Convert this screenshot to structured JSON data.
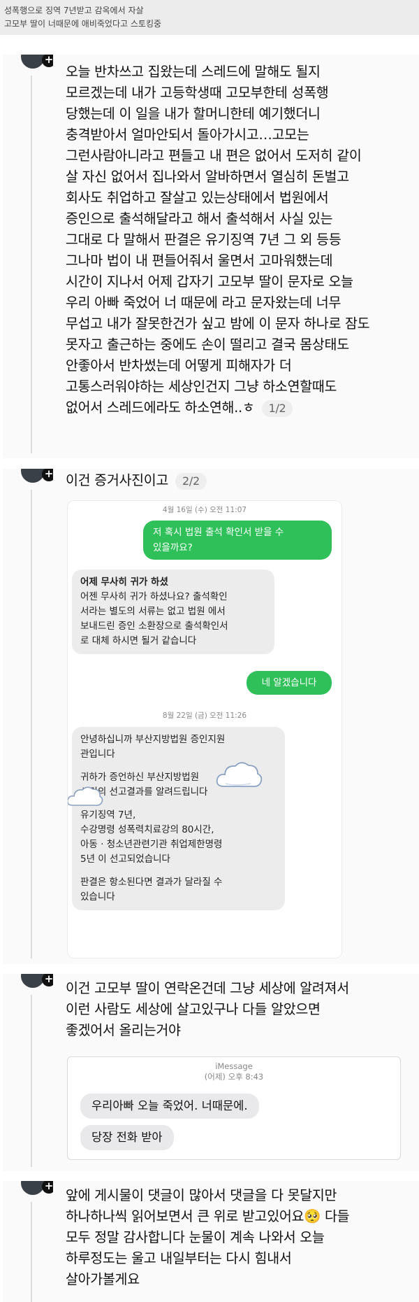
{
  "header": {
    "line1": "성폭행으로 징역 7년받고 감옥에서 자살",
    "line2": "고모부 딸이 너때문에 애비죽었다고 스토킹중"
  },
  "post1": {
    "lines": [
      "오늘 반차쓰고 집왔는데 스레드에 말해도 될지",
      "모르겠는데 내가 고등학생때 고모부한테 성폭행",
      "당했는데 이 일을 내가 할머니한테 예기했더니",
      "충격받아서 얼마안되서 돌아가시고…고모는",
      "그런사람아니라고 편들고 내 편은 없어서 도저히 같이",
      "살 자신 없어서 집나와서 알바하면서 열심히 돈벌고",
      "회사도 취업하고 잘살고 있는상태에서 법원에서",
      "증인으로 출석해달라고 해서 출석해서 사실 있는",
      "그대로 다 말해서 판결은 유기징역 7년 그 외 등등",
      "그나마 법이 내 편들어줘서 울면서 고마워했는데",
      "시간이 지나서 어제 갑자기 고모부 딸이 문자로 오늘",
      "우리 아빠 죽었어 너 때문에 라고 문자왔는데 너무",
      "무섭고 내가 잘못한건가 싶고 밤에 이 문자 하나로 잠도",
      "못자고 출근하는 중에도 손이 떨리고 결국 몸상태도",
      "안좋아서 반차썼는데 어떻게 피해자가 더",
      "고통스러워야하는 세상인건지 그냥 하소연할때도"
    ],
    "last_line": "없어서 스레드에라도 하소연해..ㅎ",
    "counter": "1/2"
  },
  "post2": {
    "text": "이건 증거사진이고",
    "counter": "2/2",
    "screenshot": {
      "date1": "4월 16일 (수) 오전 11:07",
      "sent1": [
        "저 혹시 법원 출석 확인서 받을 수",
        "있을까요?"
      ],
      "recv1_title": "어제 무사히 귀가 하셨",
      "recv1_lines": [
        "어젠 무사히 귀가 하셨나요? 출석확인",
        "서라는 별도의 서류는 없고 법원 에서",
        "보내드린 증인 소환장으로 출석확인서",
        "로 대체 하시면 될거 같습니다"
      ],
      "sent2": "네 알겠습니다",
      "date2": "8월 22일 (금) 오전 11:26",
      "recv2_p1": [
        "안녕하십니까 부산지방법원 증인지원",
        "관입니다"
      ],
      "recv2_p2": [
        "귀하가 증언하신 부산지방법원",
        "사건의 선고결과를 알려드립니다"
      ],
      "recv2_p3": [
        "유기징역 7년,",
        "수강명령 성폭력치료강의 80시간,",
        "아동 · 청소년관련기관 취업제한명령",
        "5년 이 선고되었습니다"
      ],
      "recv2_p4": [
        "판결은 항소된다면 결과가 달라질 수",
        "있습니다"
      ]
    }
  },
  "post3": {
    "lines": [
      "이건 고모부 딸이 연락온건데 그냥 세상에 알려져서",
      "이런 사람도 세상에 살고있구나 다들 알았으면",
      "좋겠어서 올리는거야"
    ],
    "screenshot": {
      "service": "iMessage",
      "time": "(어제) 오후 8:43",
      "msg1": "우리아빠 오늘 죽었어. 너때문에.",
      "msg2": "당장 전화 받아"
    }
  },
  "post4": {
    "lines": [
      "앞에 게시물이 댓글이 많아서 댓글을 다 못달지만",
      "하나하나씩 읽어보면서 큰 위로 받고있어요🥺 다들",
      "모두 정말 감사합니다 눈물이 계속 나와서 오늘",
      "하루정도는 울고 내일부터는 다시 힘내서",
      "살아가볼게요"
    ]
  },
  "colors": {
    "sent_bubble": "#2fc05a",
    "received_bubble": "#ececec",
    "imessage_bubble": "#e9e9eb",
    "header_bg": "#ececec"
  }
}
